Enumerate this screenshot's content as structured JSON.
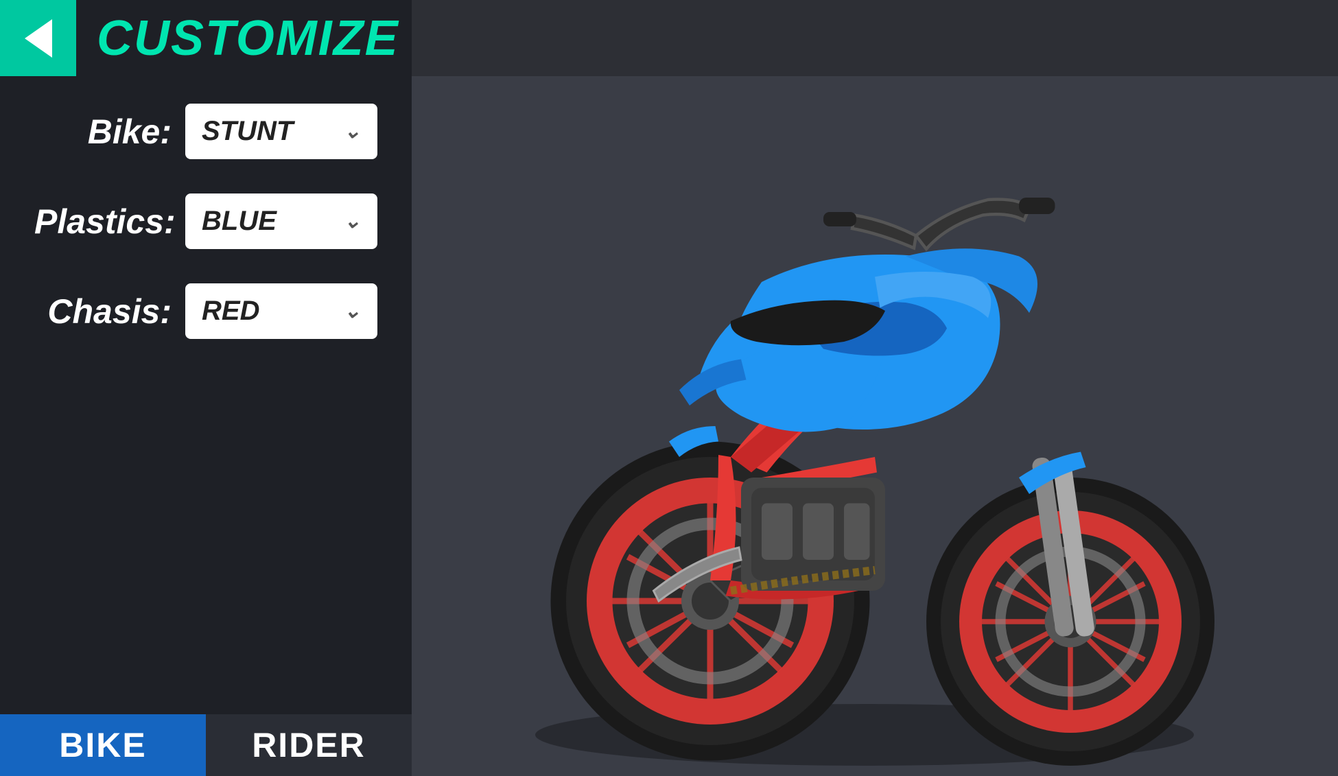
{
  "header": {
    "title": "CUSTOMIZE",
    "back_label": "back"
  },
  "left_panel": {
    "bike_label": "Bike:",
    "bike_value": "STUNT",
    "plastics_label": "Plastics:",
    "plastics_value": "BLUE",
    "chasis_label": "Chasis:",
    "chasis_value": "RED"
  },
  "bottom_tabs": {
    "bike_label": "BIKE",
    "rider_label": "RIDER"
  },
  "colors": {
    "accent": "#00e5b0",
    "back_bg": "#00c8a0",
    "header_bg": "#1e2026",
    "panel_bg": "#1e2026",
    "preview_bg": "#3a3d46",
    "tab_bike_bg": "#1565c0",
    "tab_rider_bg": "#2a2d35",
    "plastics_color": "#2196f3",
    "chasis_color": "#e53935",
    "wheel_color": "#e53935"
  }
}
